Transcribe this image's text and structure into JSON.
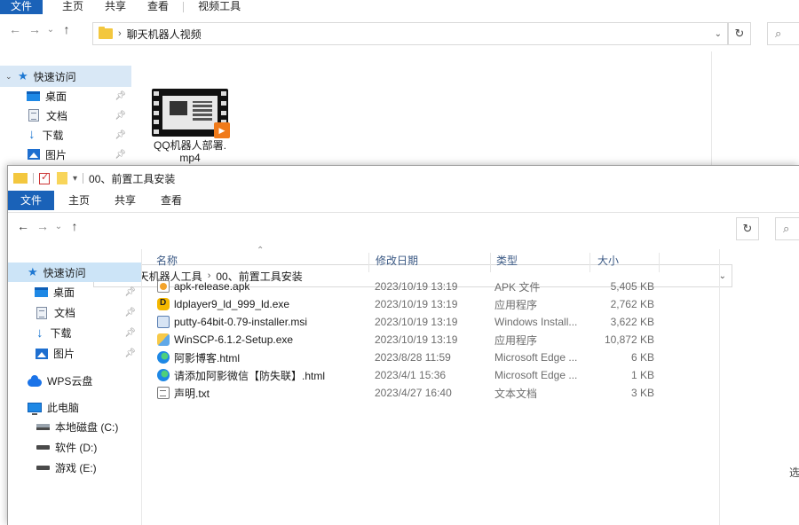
{
  "back_window": {
    "ribbon_tabs": [
      "文件",
      "主页",
      "共享",
      "查看",
      "视频工具"
    ],
    "address": {
      "crumbs": [
        "聊天机器人视频"
      ]
    },
    "nav": {
      "quick_access": "快速访问",
      "items": [
        {
          "label": "桌面",
          "icon": "desktop-icon"
        },
        {
          "label": "文档",
          "icon": "documents-icon"
        },
        {
          "label": "下载",
          "icon": "download-icon"
        },
        {
          "label": "图片",
          "icon": "pictures-icon"
        }
      ]
    },
    "files": [
      {
        "name_line1": "QQ机器人部署.",
        "name_line2": "mp4",
        "icon": "video-file-icon"
      }
    ]
  },
  "front_window": {
    "title": "00、前置工具安装",
    "ribbon_tabs": [
      "文件",
      "主页",
      "共享",
      "查看"
    ],
    "address": {
      "crumbs": [
        "聊天机器人工具",
        "00、前置工具安装"
      ]
    },
    "nav": {
      "quick_access": "快速访问",
      "items": [
        {
          "label": "桌面"
        },
        {
          "label": "文档"
        },
        {
          "label": "下载"
        },
        {
          "label": "图片"
        }
      ],
      "wps": "WPS云盘",
      "this_pc": "此电脑",
      "drives": [
        {
          "label": "本地磁盘 (C:)"
        },
        {
          "label": "软件 (D:)"
        },
        {
          "label": "游戏 (E:)"
        }
      ]
    },
    "columns": {
      "name": "名称",
      "date": "修改日期",
      "type": "类型",
      "size": "大小"
    },
    "files": [
      {
        "name": "apk-release.apk",
        "date": "2023/10/19 13:19",
        "type": "APK 文件",
        "size": "5,405 KB",
        "icon": "apk-file-icon"
      },
      {
        "name": "ldplayer9_ld_999_ld.exe",
        "date": "2023/10/19 13:19",
        "type": "应用程序",
        "size": "2,762 KB",
        "icon": "ldplayer-exe-icon"
      },
      {
        "name": "putty-64bit-0.79-installer.msi",
        "date": "2023/10/19 13:19",
        "type": "Windows Install...",
        "size": "3,622 KB",
        "icon": "msi-installer-icon"
      },
      {
        "name": "WinSCP-6.1.2-Setup.exe",
        "date": "2023/10/19 13:19",
        "type": "应用程序",
        "size": "10,872 KB",
        "icon": "winscp-exe-icon"
      },
      {
        "name": "阿影博客.html",
        "date": "2023/8/28 11:59",
        "type": "Microsoft Edge ...",
        "size": "6 KB",
        "icon": "edge-html-icon"
      },
      {
        "name": "请添加阿影微信【防失联】.html",
        "date": "2023/4/1 15:36",
        "type": "Microsoft Edge ...",
        "size": "1 KB",
        "icon": "edge-html-icon"
      },
      {
        "name": "声明.txt",
        "date": "2023/4/27 16:40",
        "type": "文本文档",
        "size": "3 KB",
        "icon": "text-file-icon"
      }
    ],
    "status_right": "选"
  }
}
